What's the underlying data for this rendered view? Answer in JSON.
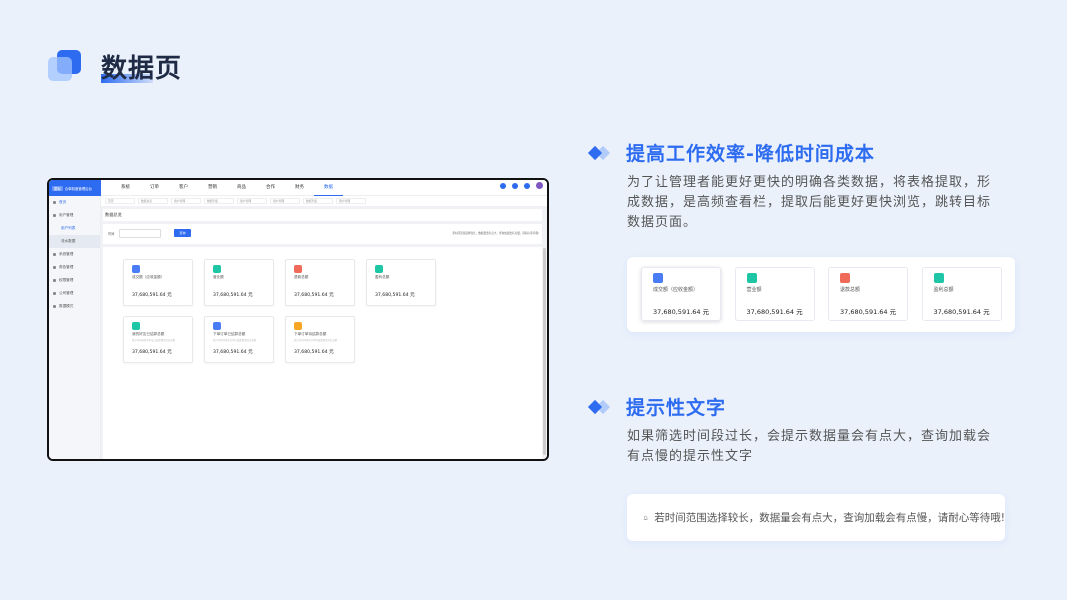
{
  "page_title": "数据页",
  "mockup": {
    "brand": "合单制度管理后台",
    "brand_tag": "图标",
    "nav": [
      "系统",
      "订单",
      "客户",
      "营销",
      "商品",
      "合作",
      "财务",
      "数据"
    ],
    "nav_active_index": 7,
    "top_icons": [
      "refresh-icon",
      "user-icon",
      "message-icon",
      "avatar"
    ],
    "sidebar": [
      {
        "label": "首页",
        "type": "home"
      },
      {
        "label": "用户管理",
        "type": "group"
      },
      {
        "label": "用户列表",
        "type": "sub"
      },
      {
        "label": "流水数据",
        "type": "sel"
      },
      {
        "label": "系统管理",
        "type": "group"
      },
      {
        "label": "角色管理",
        "type": "group"
      },
      {
        "label": "权限管理",
        "type": "group"
      },
      {
        "label": "公司管理",
        "type": "group"
      },
      {
        "label": "数据模式",
        "type": "group"
      }
    ],
    "tabs": [
      "首页",
      "数据总览",
      "用户管理",
      "数据列表",
      "用户管理",
      "用户管理",
      "数据列表",
      "用户管理"
    ],
    "section_title": "数据总览",
    "filter_label": "时间",
    "filter_button": "查询",
    "filter_tip": "若时间范围选择较长，数据量会有点大，查询加载会有点慢，请耐心等待哦!",
    "cards": [
      {
        "label": "成交额（应收金额）",
        "sub": "",
        "value": "37,680,591.64 元",
        "color": "#4a7cf6"
      },
      {
        "label": "营业额",
        "sub": "",
        "value": "37,680,591.64 元",
        "color": "#1fc6a6"
      },
      {
        "label": "退款总额",
        "sub": "",
        "value": "37,680,591.64 元",
        "color": "#f06a5a"
      },
      {
        "label": "盈利总额",
        "sub": "",
        "value": "37,680,591.64 元",
        "color": "#1fc6a6"
      },
      {
        "label": "我的好友已结算总额",
        "sub": "统计时间内所有好友已结算佣金的总金额",
        "value": "37,680,591.64 元",
        "color": "#1fc6a6"
      },
      {
        "label": "下单订单已结算总额",
        "sub": "统计时间内所有订单已结算佣金的总金额",
        "value": "37,680,591.64 元",
        "color": "#4a7cf6"
      },
      {
        "label": "下单订单待结算总额",
        "sub": "统计时间内所有订单待结算佣金的总金额",
        "value": "37,680,591.64 元",
        "color": "#f5a623"
      }
    ]
  },
  "section1": {
    "title": "提高工作效率-降低时间成本",
    "desc": "为了让管理者能更好更快的明确各类数据，将表格提取，形成数据，是高频查看栏，提取后能更好更快浏览，跳转目标数据页面。",
    "cards": [
      {
        "label": "成交额（应收金额）",
        "value": "37,680,591.64 元",
        "color": "#4a7cf6"
      },
      {
        "label": "营业额",
        "value": "37,680,591.64 元",
        "color": "#1fc6a6"
      },
      {
        "label": "退款总额",
        "value": "37,680,591.64 元",
        "color": "#f06a5a"
      },
      {
        "label": "盈利总额",
        "value": "37,680,591.64 元",
        "color": "#1fc6a6"
      }
    ]
  },
  "section2": {
    "title": "提示性文字",
    "desc": "如果筛选时间段过长，会提示数据量会有点大，查询加载会有点慢的提示性文字",
    "tip": "若时间范围选择较长，数据量会有点大，查询加载会有点慢，请耐心等待哦!"
  }
}
